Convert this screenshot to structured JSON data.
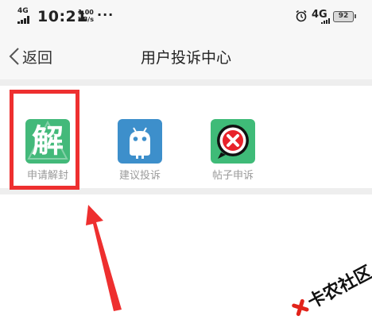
{
  "status_bar": {
    "network_top": "4G",
    "network_sub": "HD",
    "time": "10:21",
    "speed_value": "1.00",
    "speed_unit": "KB/s",
    "more": "···",
    "network_right": "4G",
    "battery": "92"
  },
  "header": {
    "back_label": "返回",
    "title": "用户投诉中心"
  },
  "services": [
    {
      "label": "申请解封",
      "icon": "unblock-icon",
      "glyph": "解",
      "color": "#43b97a"
    },
    {
      "label": "建议投诉",
      "icon": "android-icon",
      "color": "#3d8fcb"
    },
    {
      "label": "帖子申诉",
      "icon": "close-circle-icon",
      "color": "#3fbb78"
    }
  ],
  "annotation": {
    "color": "#ee2f2f"
  },
  "watermark": {
    "text": "卡农社区"
  },
  "colors": {
    "accent_red": "#ee2f2f",
    "status_bg": "#f7f7f7",
    "label_gray": "#9a9a9a"
  }
}
